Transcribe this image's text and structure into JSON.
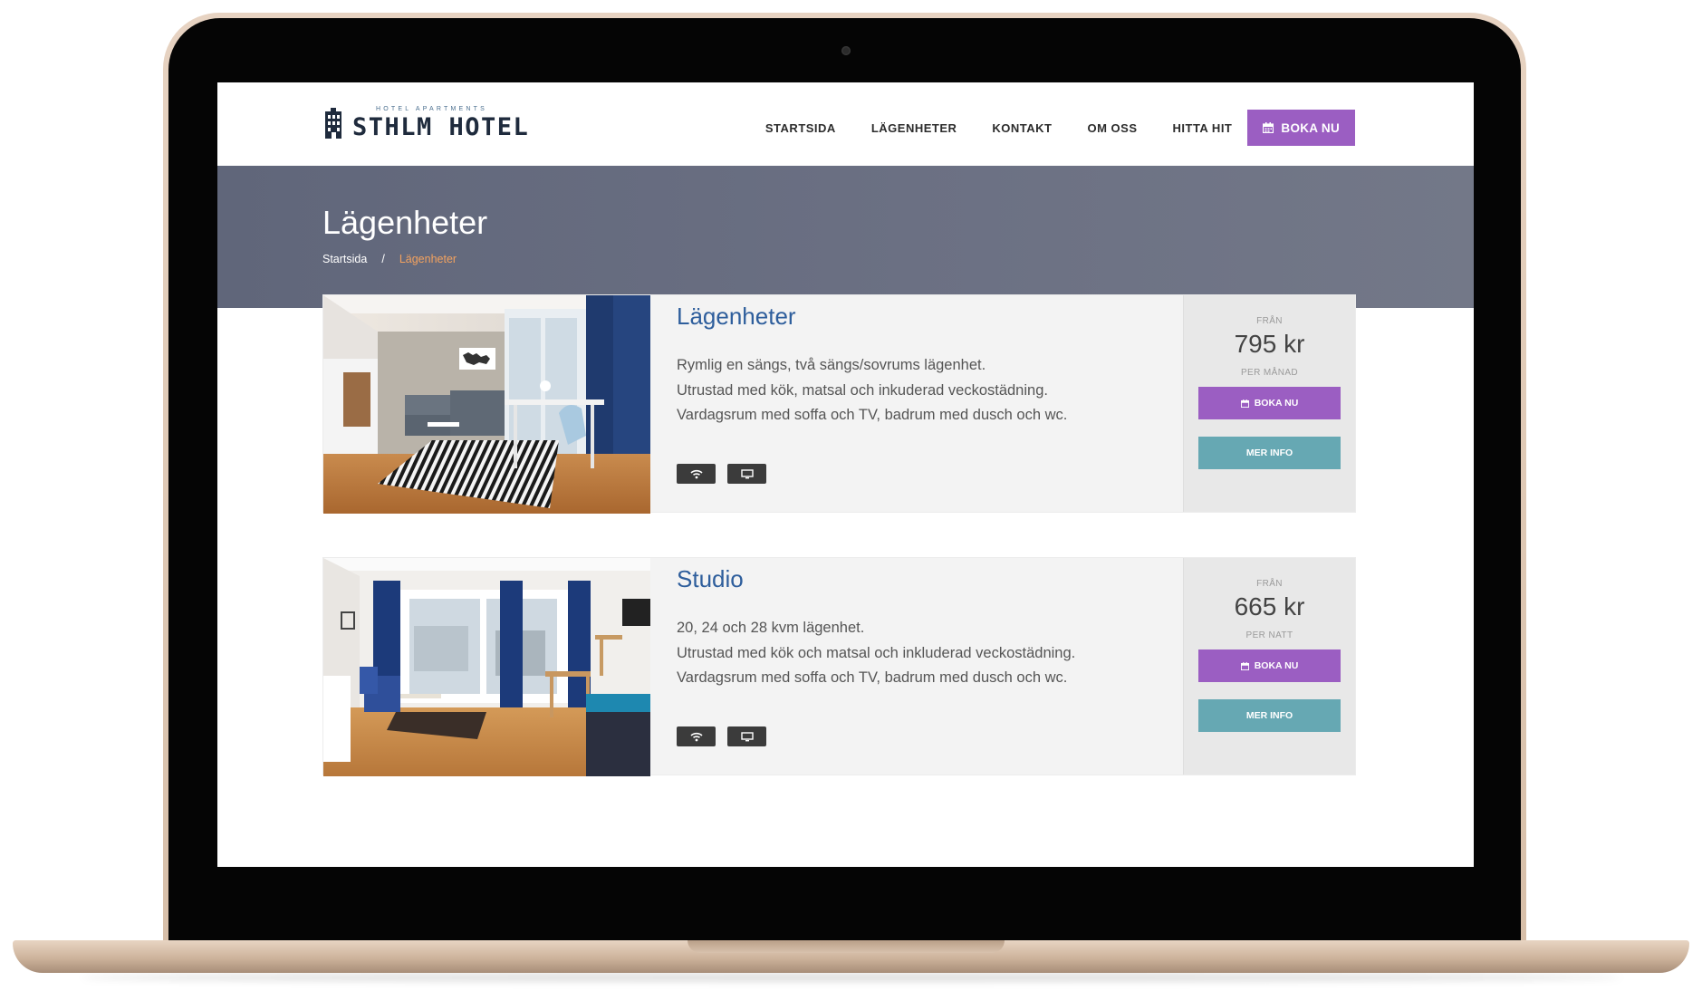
{
  "site": {
    "logo_small": "HOTEL APARTMENTS",
    "logo_main": "STHLM  HOTEL",
    "accent": "#9b5ec2",
    "info_color": "#66a8b3",
    "title_color": "#2e5e9c"
  },
  "nav": {
    "items": [
      "STARTSIDA",
      "LÄGENHETER",
      "KONTAKT",
      "OM OSS",
      "HITTA HIT"
    ],
    "book_label": "BOKA NU"
  },
  "hero": {
    "title": "Lägenheter",
    "breadcrumb": [
      "Startsida",
      "Lägenheter"
    ],
    "separator": "/"
  },
  "rooms": [
    {
      "title": "Lägenheter",
      "desc": [
        "Rymlig en sängs, två sängs/sovrums lägenhet.",
        "Utrustad med kök, matsal och inkuderad veckostädning.",
        "Vardagsrum med soffa och TV, badrum med dusch och wc."
      ],
      "amenities": [
        "wifi-icon",
        "tv-icon"
      ],
      "from_label": "FRÅN",
      "price": "795 kr",
      "period": "PER MÅNAD",
      "book_label": "BOKA NU",
      "info_label": "MER INFO"
    },
    {
      "title": "Studio",
      "desc": [
        "20, 24 och 28 kvm lägenhet.",
        "Utrustad med kök och matsal och inkluderad veckostädning.",
        "Vardagsrum med soffa och TV, badrum med dusch och wc."
      ],
      "amenities": [
        "wifi-icon",
        "tv-icon"
      ],
      "from_label": "FRÅN",
      "price": "665 kr",
      "period": "PER NATT",
      "book_label": "BOKA NU",
      "info_label": "MER INFO"
    }
  ]
}
